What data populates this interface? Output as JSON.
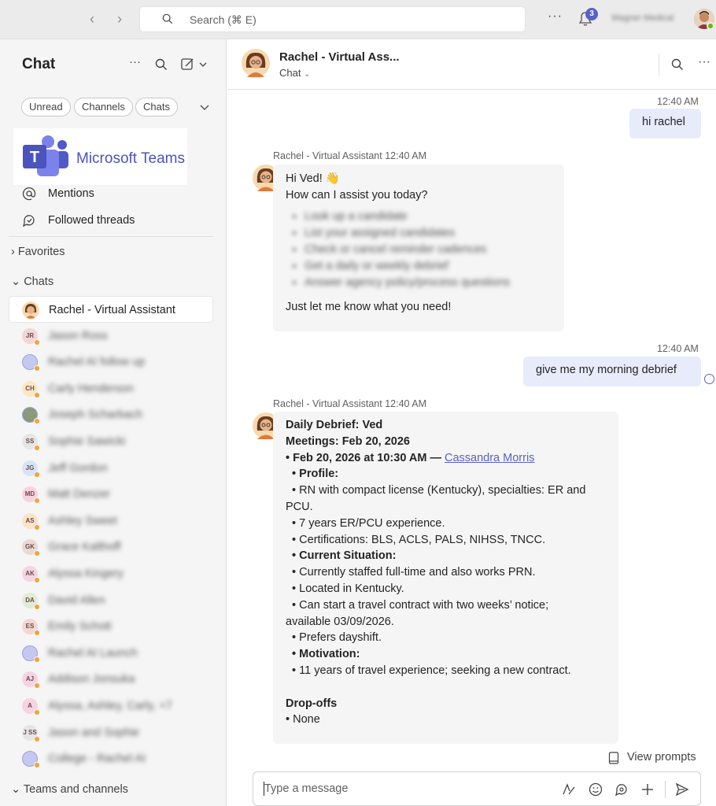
{
  "topbar": {
    "search_placeholder": "Search (⌘ E)",
    "notification_count": "3",
    "user_name": "Wagner Medical"
  },
  "sidebar": {
    "title": "Chat",
    "filters": [
      "Unread",
      "Channels",
      "Chats"
    ],
    "logo_text": "Microsoft Teams",
    "quick_links": [
      "Mentions",
      "Followed threads"
    ],
    "favorites_label": "Favorites",
    "chats_label": "Chats",
    "teams_label": "Teams and channels",
    "chats": [
      {
        "name": "Rachel - Virtual Assistant",
        "initials": "",
        "color": "#f7d9b0"
      },
      {
        "name": "Jason Ross",
        "initials": "JR",
        "color": "#f4d6d3"
      },
      {
        "name": "Rachel AI follow up",
        "initials": "",
        "color": "#c5c9f0"
      },
      {
        "name": "Carly Henderson",
        "initials": "CH",
        "color": "#fbe8c2"
      },
      {
        "name": "Joseph Scharbach",
        "initials": "",
        "color": "#8a9a7a"
      },
      {
        "name": "Sophie Sawicki",
        "initials": "SS",
        "color": "#e5e5e5"
      },
      {
        "name": "Jeff Gordon",
        "initials": "JG",
        "color": "#d6e4f5"
      },
      {
        "name": "Matt Denzer",
        "initials": "MD",
        "color": "#f9d2df"
      },
      {
        "name": "Ashley Sweet",
        "initials": "AS",
        "color": "#fbe3c7"
      },
      {
        "name": "Grace Kalthoff",
        "initials": "GK",
        "color": "#ead9d2"
      },
      {
        "name": "Alyssa Kingery",
        "initials": "AK",
        "color": "#f6d3e3"
      },
      {
        "name": "David Allen",
        "initials": "DA",
        "color": "#e1ecd4"
      },
      {
        "name": "Emily Schott",
        "initials": "ES",
        "color": "#f4d6d3"
      },
      {
        "name": "Rachel AI Launch",
        "initials": "",
        "color": "#c5c9f0"
      },
      {
        "name": "Addison Jonsuka",
        "initials": "AJ",
        "color": "#f6d3e3"
      },
      {
        "name": "Alyssa, Ashley, Carly, +7",
        "initials": "A",
        "color": "#f6d3e3"
      },
      {
        "name": "Jason and Sophie",
        "initials": "J SS",
        "color": "#e5e5e5"
      },
      {
        "name": "College - Rachel AI",
        "initials": "",
        "color": "#c5c9f0"
      }
    ]
  },
  "header": {
    "title": "Rachel - Virtual Ass...",
    "subtitle": "Chat"
  },
  "messages": {
    "m1_time": "12:40 AM",
    "m1_text": "hi rachel",
    "m2_sender": "Rachel - Virtual Assistant  12:40 AM",
    "m2_greeting": "Hi Ved! 👋",
    "m2_question": "How can I assist you today?",
    "m2_options": [
      "Look up a candidate",
      "List your assigned candidates",
      "Check or cancel reminder cadences",
      "Get a daily or weekly debrief",
      "Answer agency policy/process questions"
    ],
    "m2_closing": "Just let me know what you need!",
    "m3_time": "12:40 AM",
    "m3_text": "give me my morning debrief",
    "m4_sender": "Rachel - Virtual Assistant  12:40 AM",
    "m4_title": "Daily Debrief: Ved",
    "m4_meetings": "Meetings: Feb 20, 2026",
    "m4_meeting_line": "• Feb 20, 2026 at 10:30 AM — ",
    "m4_meeting_link": "Cassandra Morris",
    "m4_profile": "  • Profile:",
    "m4_l1": "  • RN with compact license (Kentucky), specialties: ER and",
    "m4_l1b": "PCU.",
    "m4_l2": "  • 7 years ER/PCU experience.",
    "m4_l3": "  • Certifications: BLS, ACLS, PALS, NIHSS, TNCC.",
    "m4_current": "  • Current Situation:",
    "m4_l4": "  • Currently staffed full-time and also works PRN.",
    "m4_l5": "  • Located in Kentucky.",
    "m4_l6": "  • Can start a travel contract with two weeks’ notice;",
    "m4_l6b": "available 03/09/2026.",
    "m4_l7": "  • Prefers dayshift.",
    "m4_motivation": "  • Motivation:",
    "m4_l8": "  • 11 years of travel experience; seeking a new contract.",
    "m4_dropoffs": "Drop-offs",
    "m4_none": "• None"
  },
  "compose": {
    "view_prompts": "View prompts",
    "placeholder": "Type a message"
  },
  "colors": {
    "accent": "#5b5fc7",
    "my_bubble": "#e8ebfa",
    "bot_bubble": "#f5f5f5"
  }
}
